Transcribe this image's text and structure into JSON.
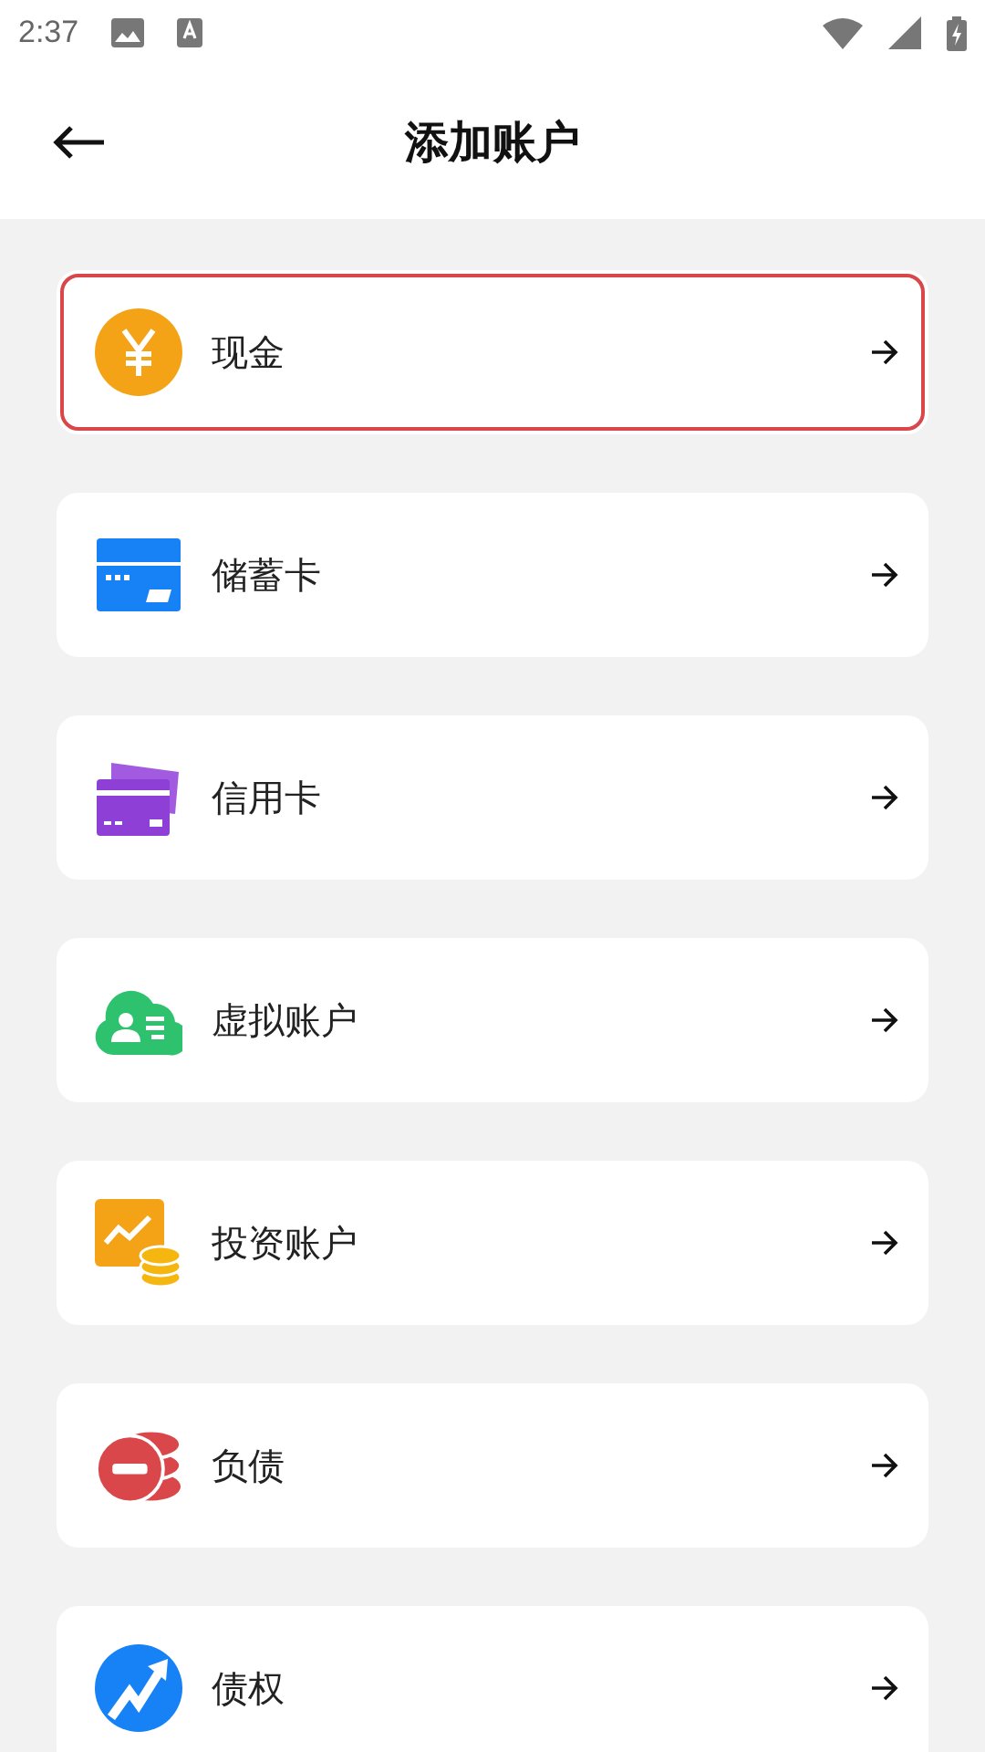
{
  "status_bar": {
    "time": "2:37"
  },
  "header": {
    "title": "添加账户"
  },
  "accounts": [
    {
      "kind": "cash",
      "label": "现金",
      "selected": true
    },
    {
      "kind": "debit",
      "label": "储蓄卡",
      "selected": false
    },
    {
      "kind": "credit",
      "label": "信用卡",
      "selected": false
    },
    {
      "kind": "virtual",
      "label": "虚拟账户",
      "selected": false
    },
    {
      "kind": "investment",
      "label": "投资账户",
      "selected": false
    },
    {
      "kind": "debt",
      "label": "负债",
      "selected": false
    },
    {
      "kind": "claim",
      "label": "债权",
      "selected": false
    }
  ]
}
